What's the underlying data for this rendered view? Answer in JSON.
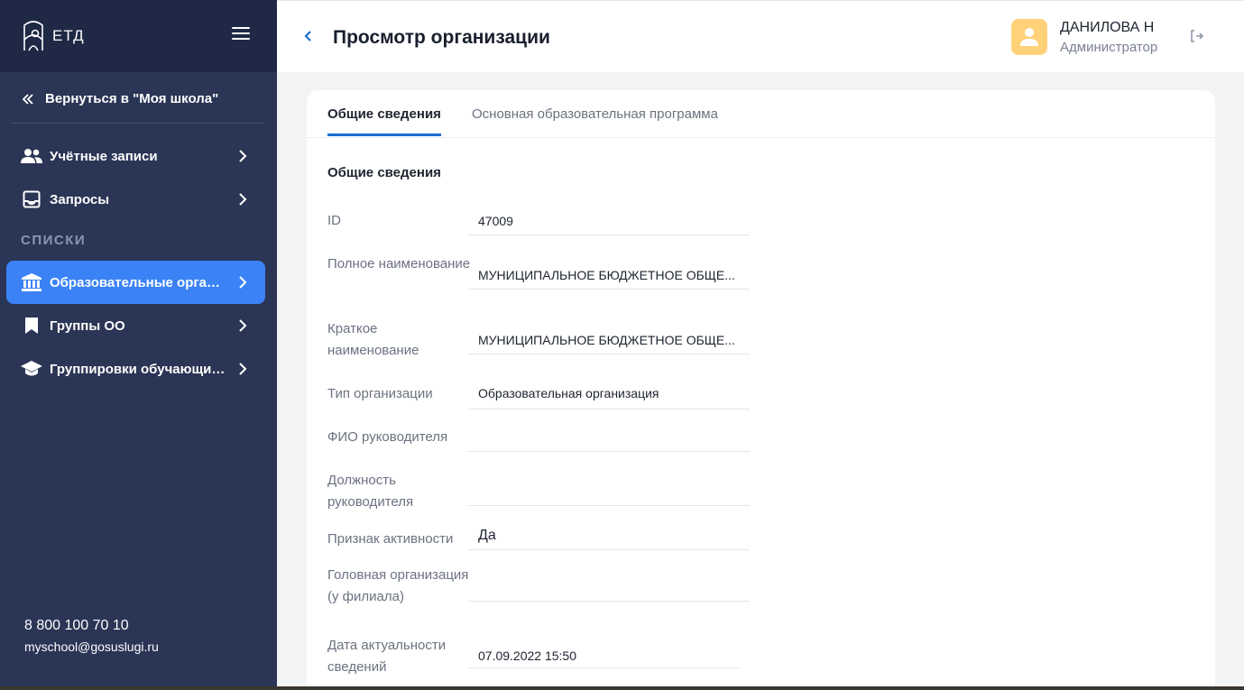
{
  "sidebar": {
    "logo_text": "ЕТД",
    "back_link": "Вернуться в \"Моя школа\"",
    "items": [
      {
        "label": "Учётные записи"
      },
      {
        "label": "Запросы"
      },
      {
        "label": "Образовательные организации"
      },
      {
        "label": "Группы ОО"
      },
      {
        "label": "Группировки обучающихся"
      }
    ],
    "section_label": "СПИСКИ",
    "phone": "8 800 100 70 10",
    "email": "myschool@gosuslugi.ru"
  },
  "header": {
    "title": "Просмотр организации",
    "user_name": "ДАНИЛОВА Н",
    "user_role": "Администратор"
  },
  "tabs": [
    "Общие сведения",
    "Основная образовательная программа"
  ],
  "section_title": "Общие сведения",
  "fields": [
    {
      "label": "ID",
      "value": "47009"
    },
    {
      "label": "Полное наименование",
      "value": "МУНИЦИПАЛЬНОЕ БЮДЖЕТНОЕ ОБЩЕ..."
    },
    {
      "label": "Краткое наименование",
      "value": "МУНИЦИПАЛЬНОЕ БЮДЖЕТНОЕ ОБЩЕ..."
    },
    {
      "label": "Тип организации",
      "value": "Образовательная организация"
    },
    {
      "label": "ФИО руководителя",
      "value": ""
    },
    {
      "label": "Должность руководителя",
      "value": ""
    },
    {
      "label": "Признак активности",
      "value": "Да"
    },
    {
      "label": "Головная организация (у филиала)",
      "value": ""
    },
    {
      "label": "Дата актуальности сведений",
      "value": "07.09.2022 15:50"
    }
  ],
  "colors": {
    "sidebar_bg": "#2b3555",
    "sidebar_top_bg": "#1f2845",
    "accent": "#3b82f6",
    "tab_underline": "#1d6fce",
    "avatar_bg": "#ffd27a"
  }
}
